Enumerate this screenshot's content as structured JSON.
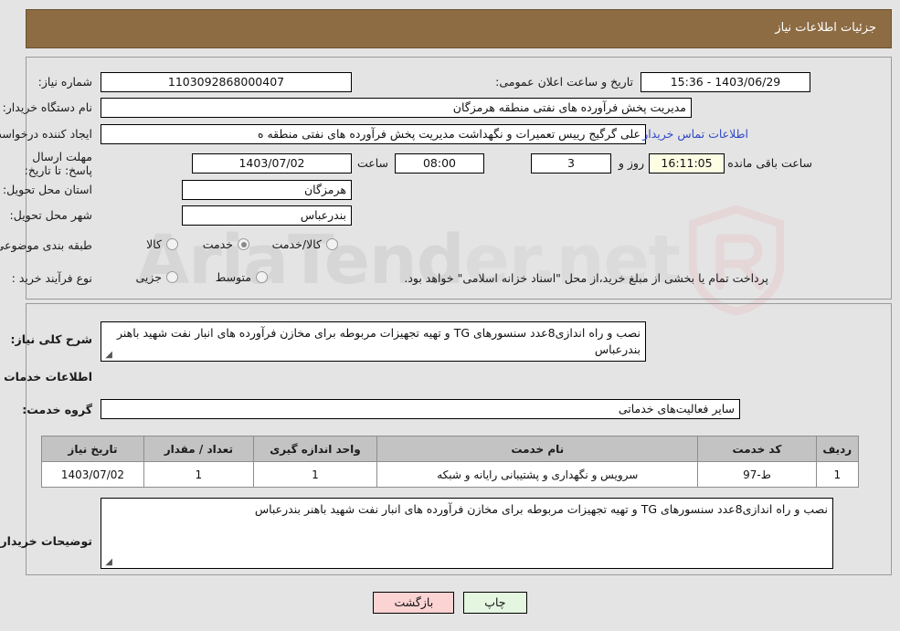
{
  "header": {
    "title": "جزئیات اطلاعات نیاز"
  },
  "form": {
    "need_number_label": "شماره نیاز:",
    "need_number_value": "1103092868000407",
    "announce_datetime_label": "تاریخ و ساعت اعلان عمومی:",
    "announce_datetime_value": "1403/06/29 - 15:36",
    "buyer_org_label": "نام دستگاه خریدار:",
    "buyer_org_value": "مدیریت پخش فرآورده های نفتی منطقه هرمزگان",
    "creator_label": "ایجاد کننده درخواست:",
    "creator_value": "علی گرگیج رییس تعمیرات و نگهداشت مدیریت پخش فرآورده های نفتی منطقه ه",
    "buyer_contact_link": "اطلاعات تماس خریدار",
    "deadline_label": "مهلت ارسال پاسخ: تا تاریخ:",
    "deadline_date_value": "1403/07/02",
    "deadline_hour_label": "ساعت",
    "deadline_hour_value": "08:00",
    "remaining_days_value": "3",
    "remaining_days_label": "روز و",
    "remaining_time_value": "16:11:05",
    "remaining_suffix_label": "ساعت باقی مانده",
    "province_label": "استان محل تحویل:",
    "province_value": "هرمزگان",
    "city_label": "شهر محل تحویل:",
    "city_value": "بندرعباس",
    "category_label": "طبقه بندی موضوعی:",
    "category_options": [
      {
        "label": "کالا",
        "selected": false
      },
      {
        "label": "خدمت",
        "selected": true
      },
      {
        "label": "کالا/خدمت",
        "selected": false
      }
    ],
    "process_type_label": "نوع فرآیند خرید :",
    "process_options": [
      {
        "label": "جزیی",
        "selected": false
      },
      {
        "label": "متوسط",
        "selected": false
      }
    ],
    "treasury_note": "پرداخت تمام یا بخشی از مبلغ خرید،از محل \"اسناد خزانه اسلامی\" خواهد بود."
  },
  "need_summary": {
    "label": "شرح کلی نیاز:",
    "value": "نصب و راه اندازی8عدد سنسورهای TG و تهیه تجهیزات مربوطه برای  مخازن فرآورده های انبار نفت شهید باهنر بندرعباس"
  },
  "services_section": {
    "heading": "اطلاعات خدمات مورد نیاز",
    "group_label": "گروه خدمت:",
    "group_value": "سایر فعالیت‌های خدماتی",
    "columns": [
      "ردیف",
      "کد خدمت",
      "نام خدمت",
      "واحد اندازه گیری",
      "تعداد / مقدار",
      "تاریخ نیاز"
    ],
    "rows": [
      {
        "row_no": "1",
        "service_code": "ط-97",
        "service_name": "سرویس و نگهداری و پشتیبانی رایانه و شبکه",
        "unit": "1",
        "quantity": "1",
        "need_date": "1403/07/02"
      }
    ]
  },
  "buyer_notes": {
    "label": "توضیحات خریدار:",
    "value": "نصب و راه اندازی8عدد سنسورهای TG و تهیه تجهیزات مربوطه برای  مخازن فرآورده های انبار نفت شهید باهنر بندرعباس"
  },
  "buttons": {
    "print": "چاپ",
    "back": "بازگشت"
  },
  "watermark": {
    "brand": "AriaTend",
    "suffix": "er.net"
  }
}
